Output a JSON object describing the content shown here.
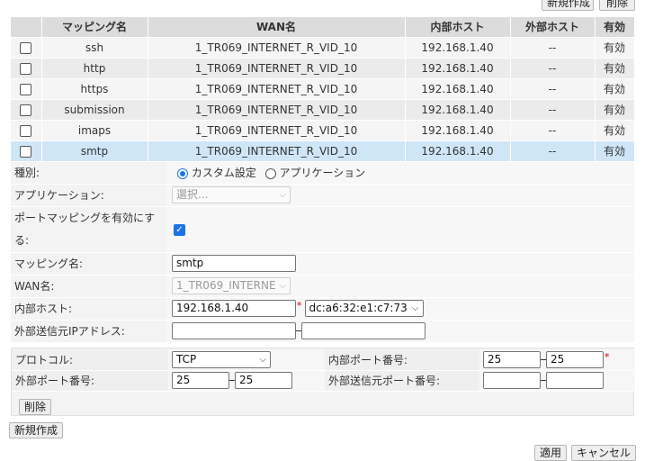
{
  "toolbar": {
    "new_label": "新規作成",
    "delete_label": "削除"
  },
  "table": {
    "headers": [
      "マッピング名",
      "WAN名",
      "内部ホスト",
      "外部ホスト",
      "有効"
    ],
    "rows": [
      {
        "name": "ssh",
        "wan": "1_TR069_INTERNET_R_VID_10",
        "internal": "192.168.1.40",
        "external": "--",
        "enabled": "有効"
      },
      {
        "name": "http",
        "wan": "1_TR069_INTERNET_R_VID_10",
        "internal": "192.168.1.40",
        "external": "--",
        "enabled": "有効"
      },
      {
        "name": "https",
        "wan": "1_TR069_INTERNET_R_VID_10",
        "internal": "192.168.1.40",
        "external": "--",
        "enabled": "有効"
      },
      {
        "name": "submission",
        "wan": "1_TR069_INTERNET_R_VID_10",
        "internal": "192.168.1.40",
        "external": "--",
        "enabled": "有効"
      },
      {
        "name": "imaps",
        "wan": "1_TR069_INTERNET_R_VID_10",
        "internal": "192.168.1.40",
        "external": "--",
        "enabled": "有効"
      },
      {
        "name": "smtp",
        "wan": "1_TR069_INTERNET_R_VID_10",
        "internal": "192.168.1.40",
        "external": "--",
        "enabled": "有効"
      }
    ]
  },
  "form": {
    "type_label": "種別:",
    "type_option_custom": "カスタム設定",
    "type_option_app": "アプリケーション",
    "app_label": "アプリケーション:",
    "app_placeholder": "選択...",
    "enable_label_1": "ポートマッピングを有効にす",
    "enable_label_2": "る:",
    "name_label": "マッピング名:",
    "name_value": "smtp",
    "wan_label": "WAN名:",
    "wan_value": "1_TR069_INTERNE",
    "internal_host_label": "内部ホスト:",
    "internal_host_value": "192.168.1.40",
    "internal_host_mac": "dc:a6:32:e1:c7:73",
    "external_src_label": "外部送信元IPアドレス:",
    "external_src_start": "",
    "external_src_end": ""
  },
  "protocol": {
    "protocol_label": "プロトコル:",
    "protocol_value": "TCP",
    "internal_port_label": "内部ポート番号:",
    "internal_port_start": "25",
    "internal_port_end": "25",
    "external_port_label": "外部ポート番号:",
    "external_port_start": "25",
    "external_port_end": "25",
    "external_src_port_label": "外部送信元ポート番号:",
    "external_src_port_start": "",
    "external_src_port_end": "",
    "delete_label": "削除"
  },
  "footer": {
    "new_label": "新規作成",
    "apply_label": "適用",
    "cancel_label": "キャンセル"
  },
  "colors": {
    "accent": "#1a73e8",
    "selected_row": "#cfe6f7",
    "required": "#dd0000"
  }
}
